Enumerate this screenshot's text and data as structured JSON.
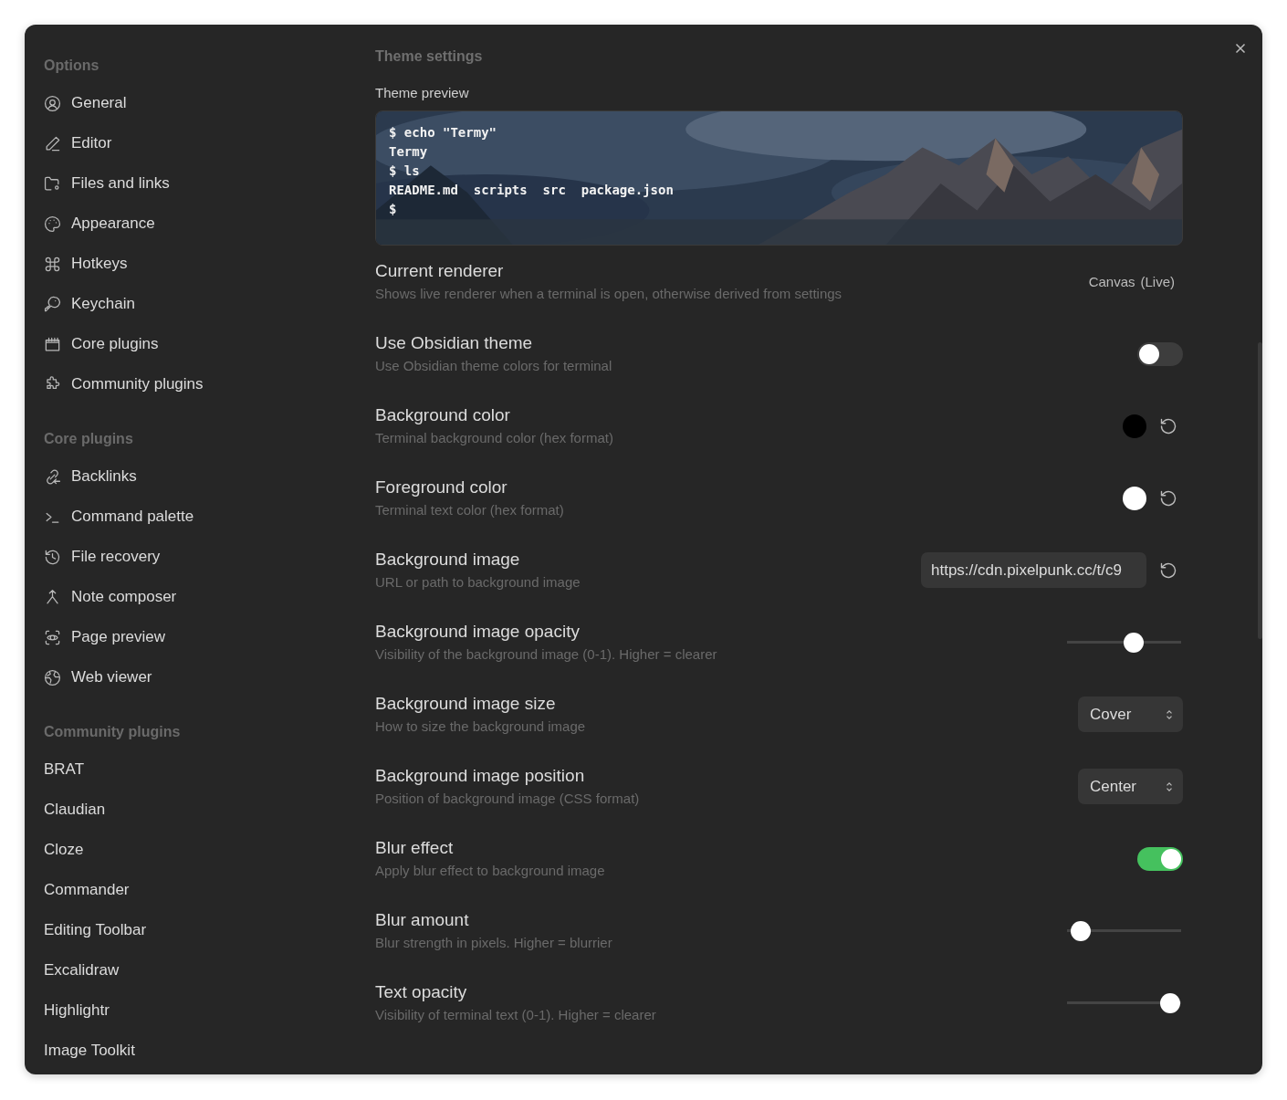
{
  "sidebar": {
    "sections": [
      {
        "title": "Options",
        "items": [
          {
            "label": "General"
          },
          {
            "label": "Editor"
          },
          {
            "label": "Files and links"
          },
          {
            "label": "Appearance"
          },
          {
            "label": "Hotkeys"
          },
          {
            "label": "Keychain"
          },
          {
            "label": "Core plugins"
          },
          {
            "label": "Community plugins"
          }
        ]
      },
      {
        "title": "Core plugins",
        "items": [
          {
            "label": "Backlinks"
          },
          {
            "label": "Command palette"
          },
          {
            "label": "File recovery"
          },
          {
            "label": "Note composer"
          },
          {
            "label": "Page preview"
          },
          {
            "label": "Web viewer"
          }
        ]
      },
      {
        "title": "Community plugins",
        "items": [
          {
            "label": "BRAT"
          },
          {
            "label": "Claudian"
          },
          {
            "label": "Cloze"
          },
          {
            "label": "Commander"
          },
          {
            "label": "Editing Toolbar"
          },
          {
            "label": "Excalidraw"
          },
          {
            "label": "Highlightr"
          },
          {
            "label": "Image Toolkit"
          }
        ]
      }
    ]
  },
  "content": {
    "heading": "Theme settings",
    "preview": {
      "label": "Theme preview",
      "lines": [
        "$ echo \"Termy\"",
        "Termy",
        "$ ls",
        "README.md  scripts  src  package.json",
        "$"
      ]
    },
    "settings": [
      {
        "kind": "info",
        "name": "Current renderer",
        "description": "Shows live renderer when a terminal is open, otherwise derived from settings",
        "value": "Canvas",
        "note": "(Live)"
      },
      {
        "kind": "toggle",
        "name": "Use Obsidian theme",
        "description": "Use Obsidian theme colors for terminal",
        "on": false
      },
      {
        "kind": "color",
        "name": "Background color",
        "description": "Terminal background color (hex format)",
        "color": "#000000"
      },
      {
        "kind": "color",
        "name": "Foreground color",
        "description": "Terminal text color (hex format)",
        "color": "#ffffff"
      },
      {
        "kind": "input",
        "name": "Background image",
        "description": "URL or path to background image",
        "value": "https://cdn.pixelpunk.cc/t/c9"
      },
      {
        "kind": "slider",
        "name": "Background image opacity",
        "description": "Visibility of the background image (0-1). Higher = clearer",
        "level": 0.58
      },
      {
        "kind": "select",
        "name": "Background image size",
        "description": "How to size the background image",
        "value": "Cover"
      },
      {
        "kind": "select",
        "name": "Background image position",
        "description": "Position of background image (CSS format)",
        "value": "Center"
      },
      {
        "kind": "toggle",
        "name": "Blur effect",
        "description": "Apply blur effect to background image",
        "on": true
      },
      {
        "kind": "slider",
        "name": "Blur amount",
        "description": "Blur strength in pixels. Higher = blurrier",
        "level": 0.12
      },
      {
        "kind": "slider",
        "name": "Text opacity",
        "description": "Visibility of terminal text (0-1). Higher = clearer",
        "level": 0.9
      }
    ]
  }
}
